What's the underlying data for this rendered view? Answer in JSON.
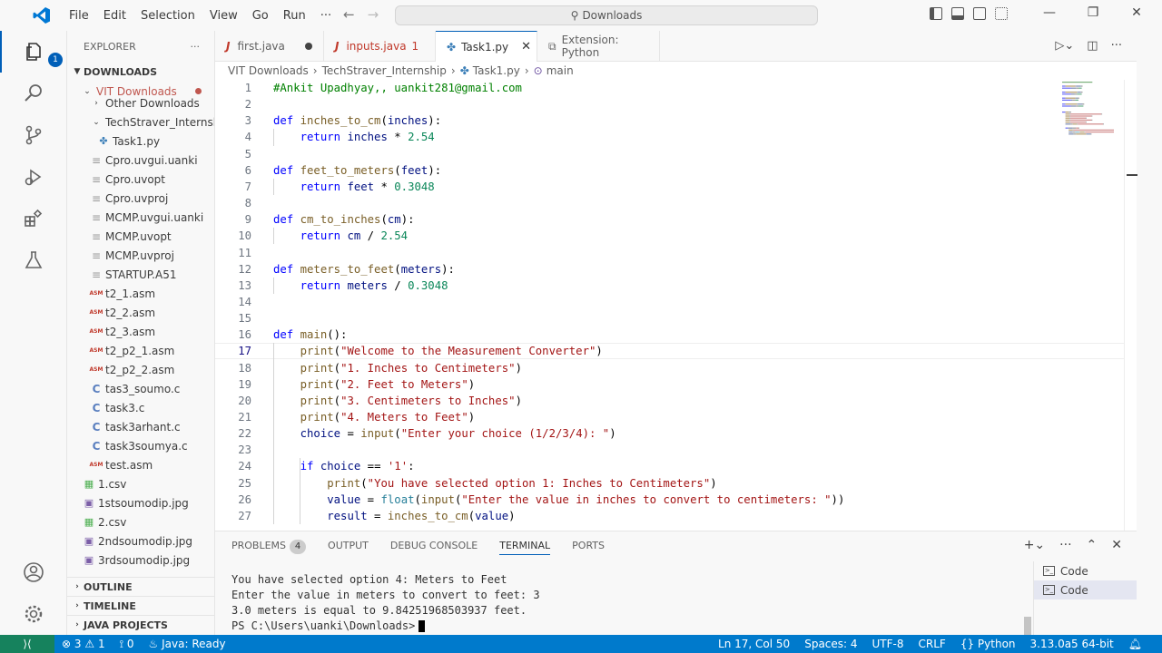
{
  "titlebar": {
    "menus": [
      "File",
      "Edit",
      "Selection",
      "View",
      "Go",
      "Run",
      "···"
    ],
    "search": "Downloads"
  },
  "sidebar": {
    "header": "EXPLORER",
    "root": "DOWNLOADS",
    "folder": "VIT Downloads",
    "items": [
      {
        "label": "Other Downloads",
        "indent": 2,
        "icon": "chevron-right"
      },
      {
        "label": "TechStraver_Internsh...",
        "indent": 2,
        "icon": "chevron-down"
      },
      {
        "label": "Task1.py",
        "indent": 3,
        "icon": "python"
      },
      {
        "label": "Cpro.uvgui.uanki",
        "indent": 2,
        "icon": "file-lines"
      },
      {
        "label": "Cpro.uvopt",
        "indent": 2,
        "icon": "file-lines"
      },
      {
        "label": "Cpro.uvproj",
        "indent": 2,
        "icon": "file-lines"
      },
      {
        "label": "MCMP.uvgui.uanki",
        "indent": 2,
        "icon": "file-lines"
      },
      {
        "label": "MCMP.uvopt",
        "indent": 2,
        "icon": "file-lines"
      },
      {
        "label": "MCMP.uvproj",
        "indent": 2,
        "icon": "file-lines"
      },
      {
        "label": "STARTUP.A51",
        "indent": 2,
        "icon": "file-lines"
      },
      {
        "label": "t2_1.asm",
        "indent": 2,
        "icon": "asm"
      },
      {
        "label": "t2_2.asm",
        "indent": 2,
        "icon": "asm"
      },
      {
        "label": "t2_3.asm",
        "indent": 2,
        "icon": "asm"
      },
      {
        "label": "t2_p2_1.asm",
        "indent": 2,
        "icon": "asm"
      },
      {
        "label": "t2_p2_2.asm",
        "indent": 2,
        "icon": "asm"
      },
      {
        "label": "tas3_soumo.c",
        "indent": 2,
        "icon": "c"
      },
      {
        "label": "task3.c",
        "indent": 2,
        "icon": "c"
      },
      {
        "label": "task3arhant.c",
        "indent": 2,
        "icon": "c"
      },
      {
        "label": "task3soumya.c",
        "indent": 2,
        "icon": "c"
      },
      {
        "label": "test.asm",
        "indent": 2,
        "icon": "asm"
      },
      {
        "label": "1.csv",
        "indent": 1,
        "icon": "csv"
      },
      {
        "label": "1stsoumodip.jpg",
        "indent": 1,
        "icon": "img"
      },
      {
        "label": "2.csv",
        "indent": 1,
        "icon": "csv"
      },
      {
        "label": "2ndsoumodip.jpg",
        "indent": 1,
        "icon": "img"
      },
      {
        "label": "3rdsoumodip.jpg",
        "indent": 1,
        "icon": "img"
      }
    ],
    "sections": [
      "OUTLINE",
      "TIMELINE",
      "JAVA PROJECTS"
    ]
  },
  "tabs": [
    {
      "label": "first.java",
      "type": "java",
      "state": "modified"
    },
    {
      "label": "inputs.java",
      "type": "java",
      "state": "errors",
      "suffix": "1"
    },
    {
      "label": "Task1.py",
      "type": "python",
      "state": "active"
    },
    {
      "label": "Extension: Python",
      "type": "extension",
      "state": "normal"
    }
  ],
  "breadcrumb": [
    "VIT Downloads",
    "TechStraver_Internship",
    "Task1.py",
    "main"
  ],
  "editor": {
    "current_line": 17,
    "lines": [
      [
        {
          "t": "#Ankit Upadhyay,, uankit281@gmail.com",
          "c": "cm"
        }
      ],
      [],
      [
        {
          "t": "def ",
          "c": "kw"
        },
        {
          "t": "inches_to_cm",
          "c": "fn"
        },
        {
          "t": "(",
          "c": "plain"
        },
        {
          "t": "inches",
          "c": "var"
        },
        {
          "t": "):",
          "c": "plain"
        }
      ],
      [
        {
          "t": "    return ",
          "c": "kw"
        },
        {
          "t": "inches",
          "c": "var"
        },
        {
          "t": " * ",
          "c": "plain"
        },
        {
          "t": "2.54",
          "c": "num"
        }
      ],
      [],
      [
        {
          "t": "def ",
          "c": "kw"
        },
        {
          "t": "feet_to_meters",
          "c": "fn"
        },
        {
          "t": "(",
          "c": "plain"
        },
        {
          "t": "feet",
          "c": "var"
        },
        {
          "t": "):",
          "c": "plain"
        }
      ],
      [
        {
          "t": "    return ",
          "c": "kw"
        },
        {
          "t": "feet",
          "c": "var"
        },
        {
          "t": " * ",
          "c": "plain"
        },
        {
          "t": "0.3048",
          "c": "num"
        }
      ],
      [],
      [
        {
          "t": "def ",
          "c": "kw"
        },
        {
          "t": "cm_to_inches",
          "c": "fn"
        },
        {
          "t": "(",
          "c": "plain"
        },
        {
          "t": "cm",
          "c": "var"
        },
        {
          "t": "):",
          "c": "plain"
        }
      ],
      [
        {
          "t": "    return ",
          "c": "kw"
        },
        {
          "t": "cm",
          "c": "var"
        },
        {
          "t": " / ",
          "c": "plain"
        },
        {
          "t": "2.54",
          "c": "num"
        }
      ],
      [],
      [
        {
          "t": "def ",
          "c": "kw"
        },
        {
          "t": "meters_to_feet",
          "c": "fn"
        },
        {
          "t": "(",
          "c": "plain"
        },
        {
          "t": "meters",
          "c": "var"
        },
        {
          "t": "):",
          "c": "plain"
        }
      ],
      [
        {
          "t": "    return ",
          "c": "kw"
        },
        {
          "t": "meters",
          "c": "var"
        },
        {
          "t": " / ",
          "c": "plain"
        },
        {
          "t": "0.3048",
          "c": "num"
        }
      ],
      [],
      [],
      [
        {
          "t": "def ",
          "c": "kw"
        },
        {
          "t": "main",
          "c": "fn"
        },
        {
          "t": "():",
          "c": "plain"
        }
      ],
      [
        {
          "t": "    ",
          "c": "plain"
        },
        {
          "t": "print",
          "c": "fn"
        },
        {
          "t": "(",
          "c": "plain"
        },
        {
          "t": "\"Welcome to the Measurement Converter\"",
          "c": "str"
        },
        {
          "t": ")",
          "c": "plain"
        }
      ],
      [
        {
          "t": "    ",
          "c": "plain"
        },
        {
          "t": "print",
          "c": "fn"
        },
        {
          "t": "(",
          "c": "plain"
        },
        {
          "t": "\"1. Inches to Centimeters\"",
          "c": "str"
        },
        {
          "t": ")",
          "c": "plain"
        }
      ],
      [
        {
          "t": "    ",
          "c": "plain"
        },
        {
          "t": "print",
          "c": "fn"
        },
        {
          "t": "(",
          "c": "plain"
        },
        {
          "t": "\"2. Feet to Meters\"",
          "c": "str"
        },
        {
          "t": ")",
          "c": "plain"
        }
      ],
      [
        {
          "t": "    ",
          "c": "plain"
        },
        {
          "t": "print",
          "c": "fn"
        },
        {
          "t": "(",
          "c": "plain"
        },
        {
          "t": "\"3. Centimeters to Inches\"",
          "c": "str"
        },
        {
          "t": ")",
          "c": "plain"
        }
      ],
      [
        {
          "t": "    ",
          "c": "plain"
        },
        {
          "t": "print",
          "c": "fn"
        },
        {
          "t": "(",
          "c": "plain"
        },
        {
          "t": "\"4. Meters to Feet\"",
          "c": "str"
        },
        {
          "t": ")",
          "c": "plain"
        }
      ],
      [
        {
          "t": "    ",
          "c": "plain"
        },
        {
          "t": "choice",
          "c": "var"
        },
        {
          "t": " = ",
          "c": "plain"
        },
        {
          "t": "input",
          "c": "fn"
        },
        {
          "t": "(",
          "c": "plain"
        },
        {
          "t": "\"Enter your choice (1/2/3/4): \"",
          "c": "str"
        },
        {
          "t": ")",
          "c": "plain"
        }
      ],
      [],
      [
        {
          "t": "    ",
          "c": "plain"
        },
        {
          "t": "if ",
          "c": "kw"
        },
        {
          "t": "choice",
          "c": "var"
        },
        {
          "t": " == ",
          "c": "plain"
        },
        {
          "t": "'1'",
          "c": "str"
        },
        {
          "t": ":",
          "c": "plain"
        }
      ],
      [
        {
          "t": "        ",
          "c": "plain"
        },
        {
          "t": "print",
          "c": "fn"
        },
        {
          "t": "(",
          "c": "plain"
        },
        {
          "t": "\"You have selected option 1: Inches to Centimeters\"",
          "c": "str"
        },
        {
          "t": ")",
          "c": "plain"
        }
      ],
      [
        {
          "t": "        ",
          "c": "plain"
        },
        {
          "t": "value",
          "c": "var"
        },
        {
          "t": " = ",
          "c": "plain"
        },
        {
          "t": "float",
          "c": "bi"
        },
        {
          "t": "(",
          "c": "plain"
        },
        {
          "t": "input",
          "c": "fn"
        },
        {
          "t": "(",
          "c": "plain"
        },
        {
          "t": "\"Enter the value in inches to convert to centimeters: \"",
          "c": "str"
        },
        {
          "t": "))",
          "c": "plain"
        }
      ],
      [
        {
          "t": "        ",
          "c": "plain"
        },
        {
          "t": "result",
          "c": "var"
        },
        {
          "t": " = ",
          "c": "plain"
        },
        {
          "t": "inches_to_cm",
          "c": "fn"
        },
        {
          "t": "(",
          "c": "plain"
        },
        {
          "t": "value",
          "c": "var"
        },
        {
          "t": ")",
          "c": "plain"
        }
      ]
    ]
  },
  "panel": {
    "tabs": [
      "PROBLEMS",
      "OUTPUT",
      "DEBUG CONSOLE",
      "TERMINAL",
      "PORTS"
    ],
    "active_tab": "TERMINAL",
    "problems_count": "4",
    "terminal_lines": [
      "You have selected option 4: Meters to Feet",
      "Enter the value in meters to convert to feet: 3",
      "3.0 meters is equal to 9.84251968503937 feet.",
      "PS C:\\Users\\uanki\\Downloads>"
    ],
    "terminals": [
      "Code",
      "Code"
    ]
  },
  "statusbar": {
    "errors": "3",
    "warnings": "1",
    "ports": "0",
    "java": "Java: Ready",
    "position": "Ln 17, Col 50",
    "spaces": "Spaces: 4",
    "encoding": "UTF-8",
    "eol": "CRLF",
    "language": "Python",
    "interpreter": "3.13.0a5 64-bit"
  },
  "activity": {
    "explorer_badge": "1"
  },
  "colors": {
    "accent": "#005fb8",
    "statusbar": "#007acc",
    "remote": "#16825d"
  }
}
